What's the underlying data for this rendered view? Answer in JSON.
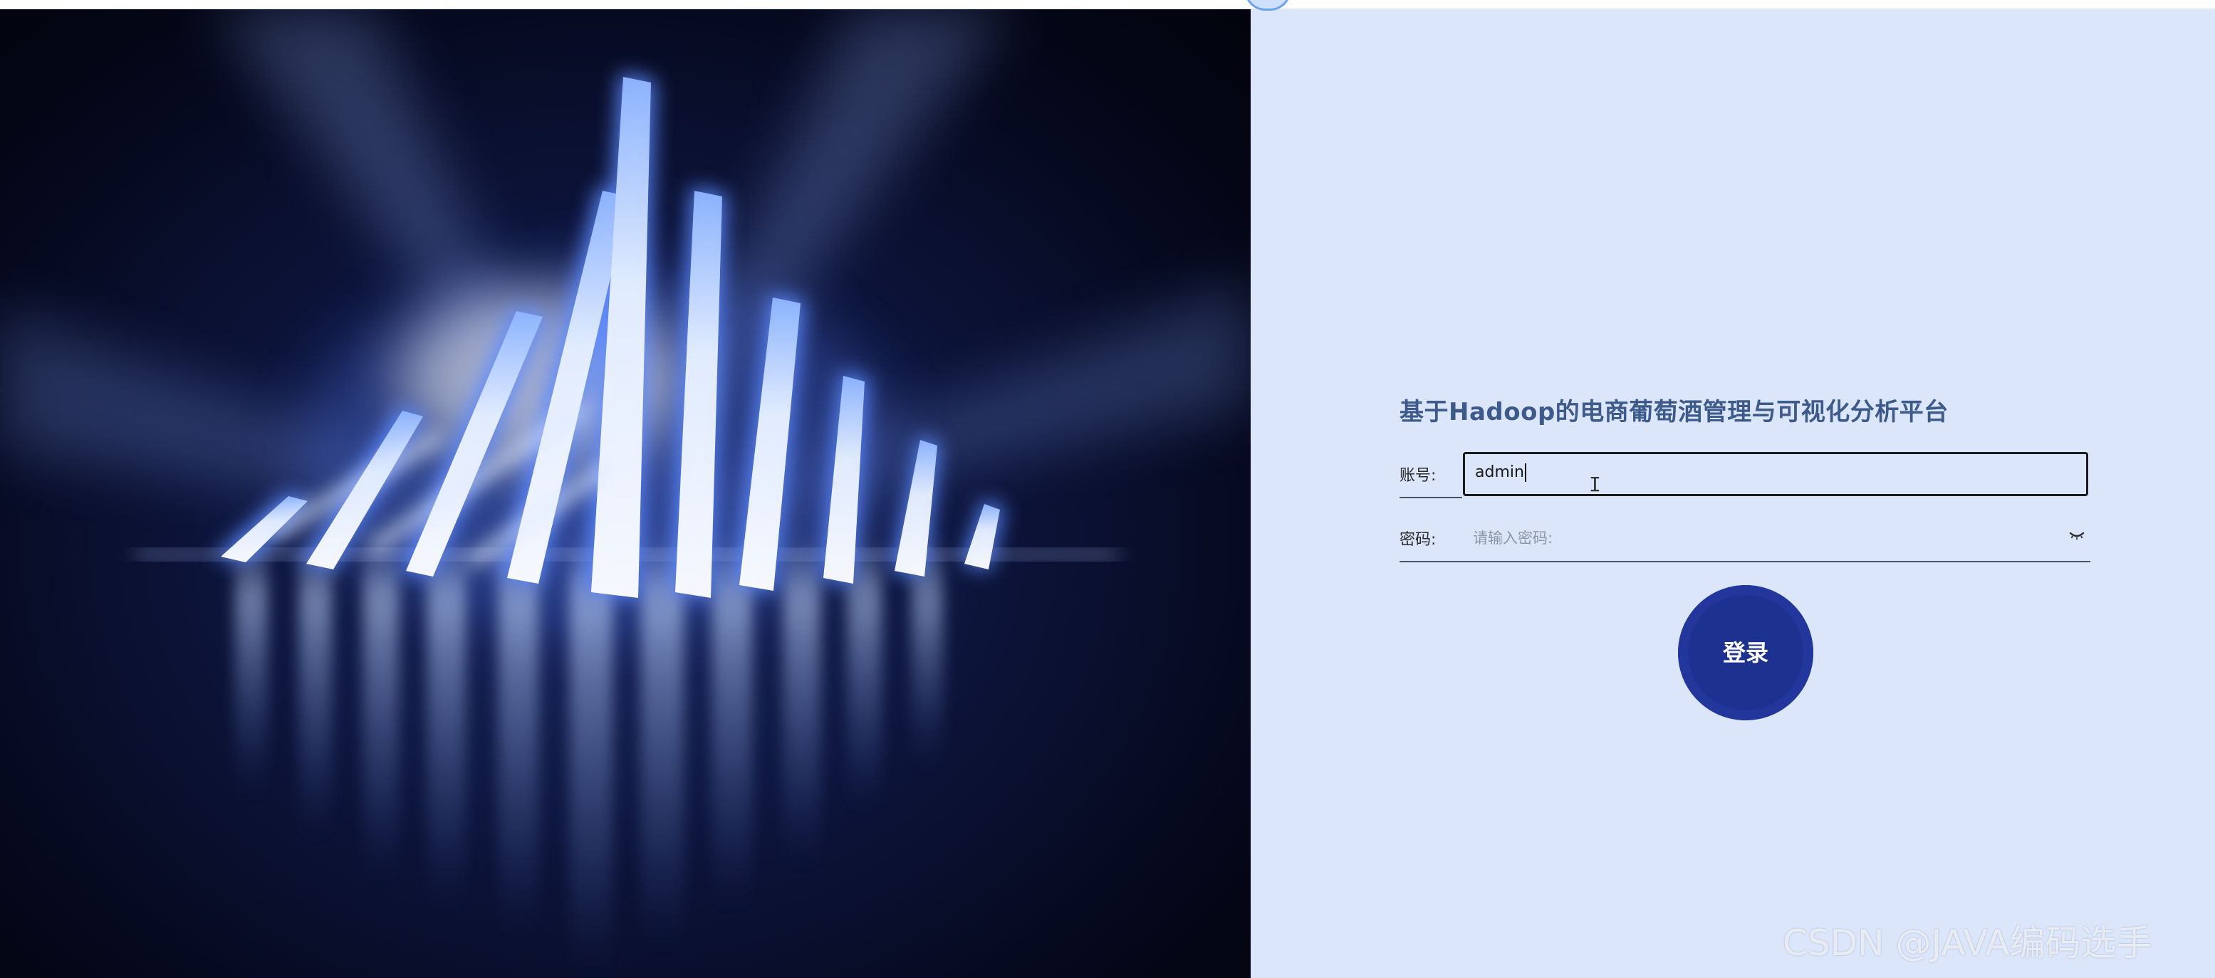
{
  "form": {
    "title": "基于Hadoop的电商葡萄酒管理与可视化分析平台",
    "account": {
      "label": "账号:",
      "value": "admin"
    },
    "password": {
      "label": "密码:",
      "placeholder": "请输入密码:"
    },
    "login_label": "登录"
  },
  "watermark": "CSDN @JAVA编码选手",
  "icons": {
    "eye": "eye-closed-icon",
    "cursor": "text-cursor-icon"
  },
  "colors": {
    "panel_bg": "#dbe6fb",
    "title": "#3d5a8a",
    "login_button": "#1d3190"
  }
}
